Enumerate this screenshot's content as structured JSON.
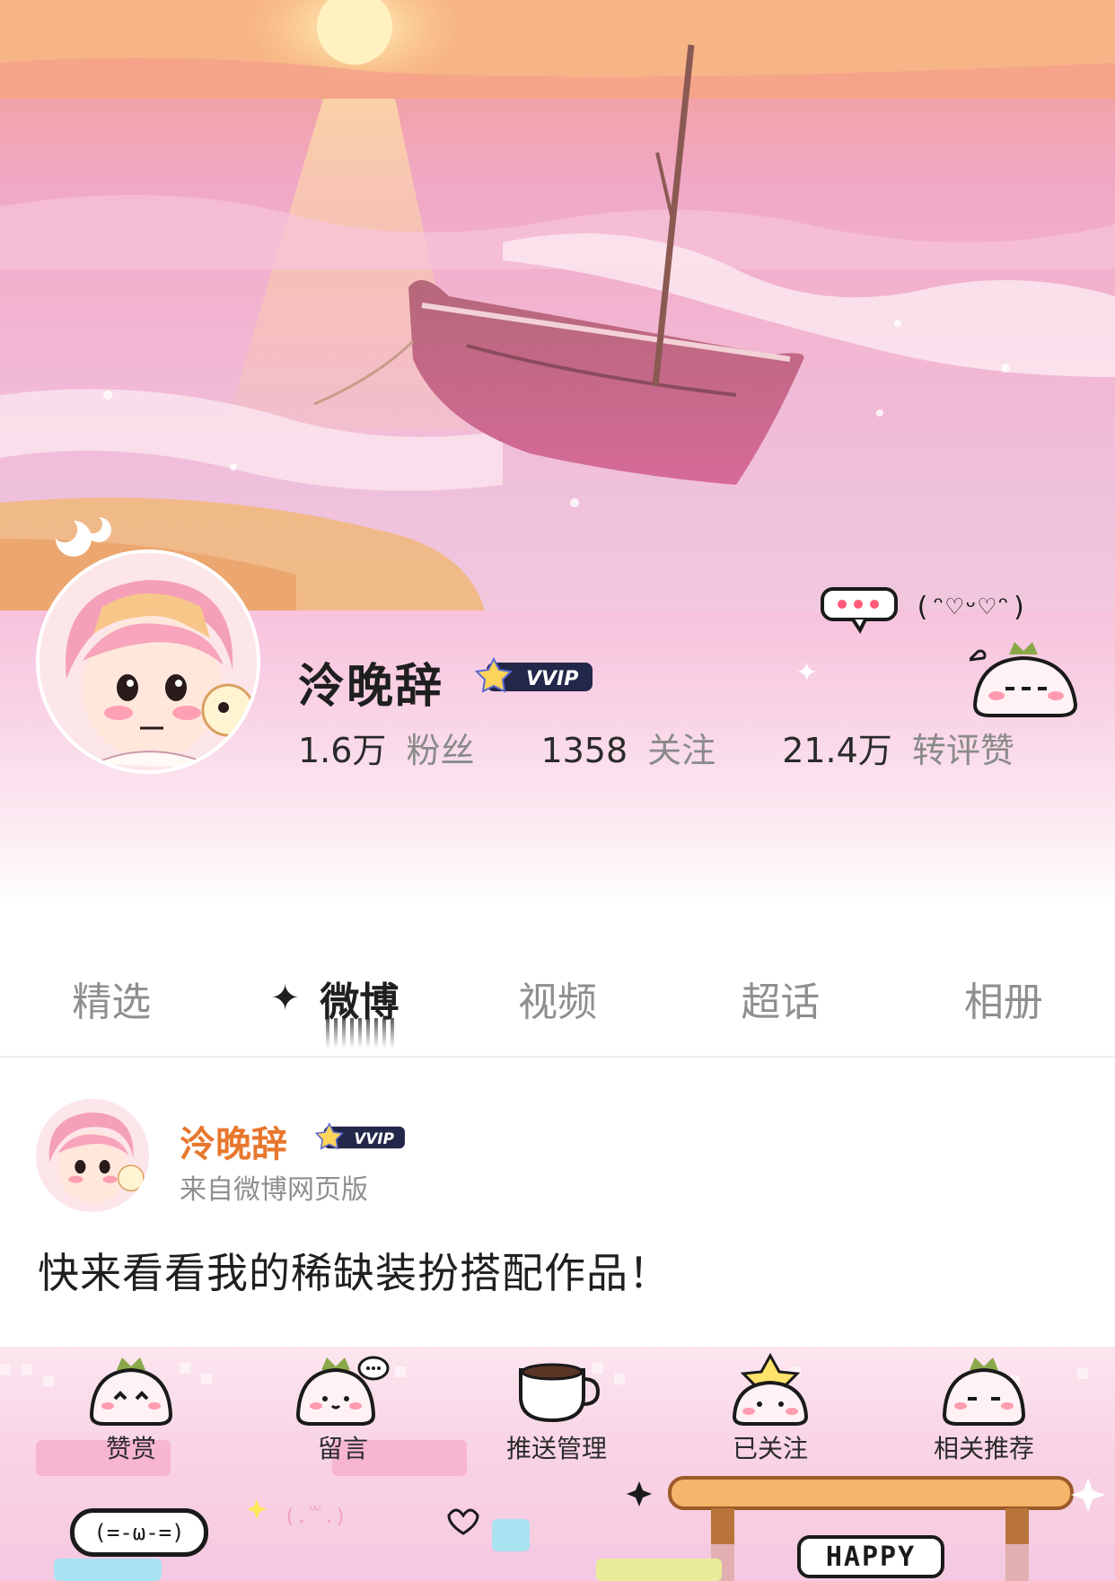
{
  "profile": {
    "nickname": "泠晚辞",
    "vvip_label": "VVIP",
    "stats": [
      {
        "value": "1.6万",
        "label": "粉丝"
      },
      {
        "value": "1358",
        "label": "关注"
      },
      {
        "value": "21.4万",
        "label": "转评赞"
      }
    ],
    "deco_face_text": "(ᵔ♡ᵕ♡ᵔ)"
  },
  "tabs": [
    {
      "label": "精选",
      "active": false
    },
    {
      "label": "微博",
      "active": true
    },
    {
      "label": "视频",
      "active": false
    },
    {
      "label": "超话",
      "active": false
    },
    {
      "label": "相册",
      "active": false
    }
  ],
  "post": {
    "author": "泠晚辞",
    "vvip_label": "VVIP",
    "source": "来自微博网页版",
    "text": "快来看看我的稀缺装扮搭配作品！"
  },
  "actions": [
    {
      "label": "赞赏",
      "icon": "mascot-reward-icon"
    },
    {
      "label": "留言",
      "icon": "mascot-comment-icon"
    },
    {
      "label": "推送管理",
      "icon": "coffee-cup-icon"
    },
    {
      "label": "已关注",
      "icon": "mascot-star-icon"
    },
    {
      "label": "相关推荐",
      "icon": "mascot-recommend-icon"
    }
  ],
  "decor": {
    "happy_sign": "HAPPY",
    "bubble_face": "(=-ω-=)"
  },
  "colors": {
    "accent_name": "#e8772e",
    "tab_inactive": "#8f8f8f",
    "pink_bg": "#f7c2dc"
  }
}
